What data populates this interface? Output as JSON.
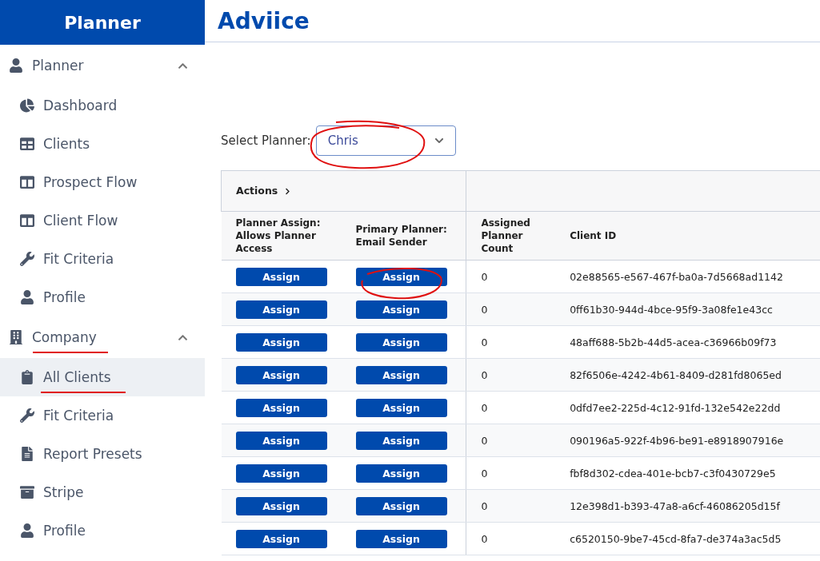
{
  "sidebar": {
    "brand": "Planner",
    "sections": [
      {
        "label": "Planner",
        "expanded": true,
        "items": [
          {
            "label": "Dashboard",
            "selected": false
          },
          {
            "label": "Clients",
            "selected": false
          },
          {
            "label": "Prospect Flow",
            "selected": false
          },
          {
            "label": "Client Flow",
            "selected": false
          },
          {
            "label": "Fit Criteria",
            "selected": false
          },
          {
            "label": "Profile",
            "selected": false
          }
        ]
      },
      {
        "label": "Company",
        "expanded": true,
        "items": [
          {
            "label": "All Clients",
            "selected": true
          },
          {
            "label": "Fit Criteria",
            "selected": false
          },
          {
            "label": "Report Presets",
            "selected": false
          },
          {
            "label": "Stripe",
            "selected": false
          },
          {
            "label": "Profile",
            "selected": false
          }
        ]
      }
    ]
  },
  "page": {
    "title": "Adviice"
  },
  "planner_select": {
    "label": "Select Planner:",
    "value": "Chris"
  },
  "table": {
    "actions_label": "Actions",
    "columns": [
      "Planner Assign: Allows Planner Access",
      "Primary Planner: Email Sender",
      "Assigned Planner Count",
      "Client ID"
    ],
    "rows": [
      {
        "assign": "Assign",
        "primary": "Assign",
        "count": "0",
        "client_id": "02e88565-e567-467f-ba0a-7d5668ad1142"
      },
      {
        "assign": "Assign",
        "primary": "Assign",
        "count": "0",
        "client_id": "0ff61b30-944d-4bce-95f9-3a08fe1e43cc"
      },
      {
        "assign": "Assign",
        "primary": "Assign",
        "count": "0",
        "client_id": "48aff688-5b2b-44d5-acea-c36966b09f73"
      },
      {
        "assign": "Assign",
        "primary": "Assign",
        "count": "0",
        "client_id": "82f6506e-4242-4b61-8409-d281fd8065ed"
      },
      {
        "assign": "Assign",
        "primary": "Assign",
        "count": "0",
        "client_id": "0dfd7ee2-225d-4c12-91fd-132e542e22dd"
      },
      {
        "assign": "Assign",
        "primary": "Assign",
        "count": "0",
        "client_id": "090196a5-922f-4b96-be91-e8918907916e"
      },
      {
        "assign": "Assign",
        "primary": "Assign",
        "count": "0",
        "client_id": "fbf8d302-cdea-401e-bcb7-c3f0430729e5"
      },
      {
        "assign": "Assign",
        "primary": "Assign",
        "count": "0",
        "client_id": "12e398d1-b393-47a8-a6cf-46086205d15f"
      },
      {
        "assign": "Assign",
        "primary": "Assign",
        "count": "0",
        "client_id": "c6520150-9be7-45cd-8fa7-de374a3ac5d5"
      }
    ]
  }
}
